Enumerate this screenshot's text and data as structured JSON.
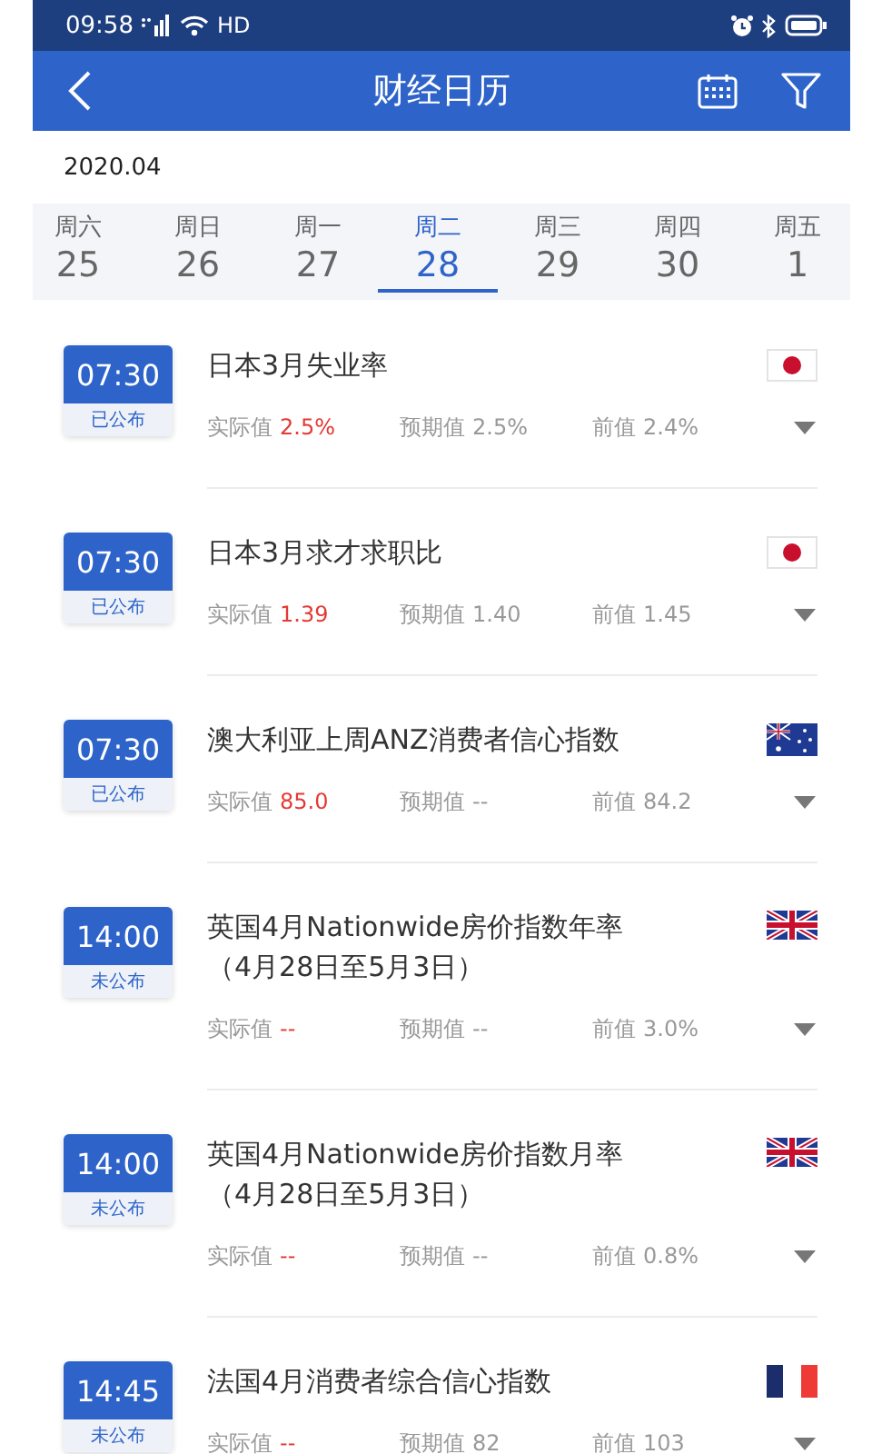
{
  "status_bar": {
    "time": "09:58",
    "network": "HD"
  },
  "header": {
    "title": "财经日历"
  },
  "month": "2020.04",
  "days": [
    {
      "weekday": "周六",
      "date": "25",
      "selected": false
    },
    {
      "weekday": "周日",
      "date": "26",
      "selected": false
    },
    {
      "weekday": "周一",
      "date": "27",
      "selected": false
    },
    {
      "weekday": "周二",
      "date": "28",
      "selected": true
    },
    {
      "weekday": "周三",
      "date": "29",
      "selected": false
    },
    {
      "weekday": "周四",
      "date": "30",
      "selected": false
    },
    {
      "weekday": "周五",
      "date": "1",
      "selected": false
    }
  ],
  "events": [
    {
      "time": "07:30",
      "status": "已公布",
      "title": "日本3月失业率",
      "kind": "jp",
      "values": [
        {
          "kind": "actual",
          "label": "实际值",
          "value": "2.5%"
        },
        {
          "kind": "forecast",
          "label": "预期值",
          "value": "2.5%"
        },
        {
          "kind": "previous",
          "label": "前值",
          "value": "2.4%"
        }
      ]
    },
    {
      "time": "07:30",
      "status": "已公布",
      "title": "日本3月求才求职比",
      "kind": "jp",
      "values": [
        {
          "kind": "actual",
          "label": "实际值",
          "value": "1.39"
        },
        {
          "kind": "forecast",
          "label": "预期值",
          "value": "1.40"
        },
        {
          "kind": "previous",
          "label": "前值",
          "value": "1.45"
        }
      ]
    },
    {
      "time": "07:30",
      "status": "已公布",
      "title": "澳大利亚上周ANZ消费者信心指数",
      "kind": "au",
      "values": [
        {
          "kind": "actual",
          "label": "实际值",
          "value": "85.0"
        },
        {
          "kind": "forecast",
          "label": "预期值",
          "value": "--"
        },
        {
          "kind": "previous",
          "label": "前值",
          "value": "84.2"
        }
      ]
    },
    {
      "time": "14:00",
      "status": "未公布",
      "title": "英国4月Nationwide房价指数年率（4月28日至5月3日）",
      "kind": "gb",
      "values": [
        {
          "kind": "actual",
          "label": "实际值",
          "value": "--"
        },
        {
          "kind": "forecast",
          "label": "预期值",
          "value": "--"
        },
        {
          "kind": "previous",
          "label": "前值",
          "value": "3.0%"
        }
      ]
    },
    {
      "time": "14:00",
      "status": "未公布",
      "title": "英国4月Nationwide房价指数月率（4月28日至5月3日）",
      "kind": "gb",
      "values": [
        {
          "kind": "actual",
          "label": "实际值",
          "value": "--"
        },
        {
          "kind": "forecast",
          "label": "预期值",
          "value": "--"
        },
        {
          "kind": "previous",
          "label": "前值",
          "value": "0.8%"
        }
      ]
    },
    {
      "time": "14:45",
      "status": "未公布",
      "title": "法国4月消费者综合信心指数",
      "kind": "fr",
      "values": [
        {
          "kind": "actual",
          "label": "实际值",
          "value": "--"
        },
        {
          "kind": "forecast",
          "label": "预期值",
          "value": "82"
        },
        {
          "kind": "previous",
          "label": "前值",
          "value": "103"
        }
      ]
    }
  ]
}
